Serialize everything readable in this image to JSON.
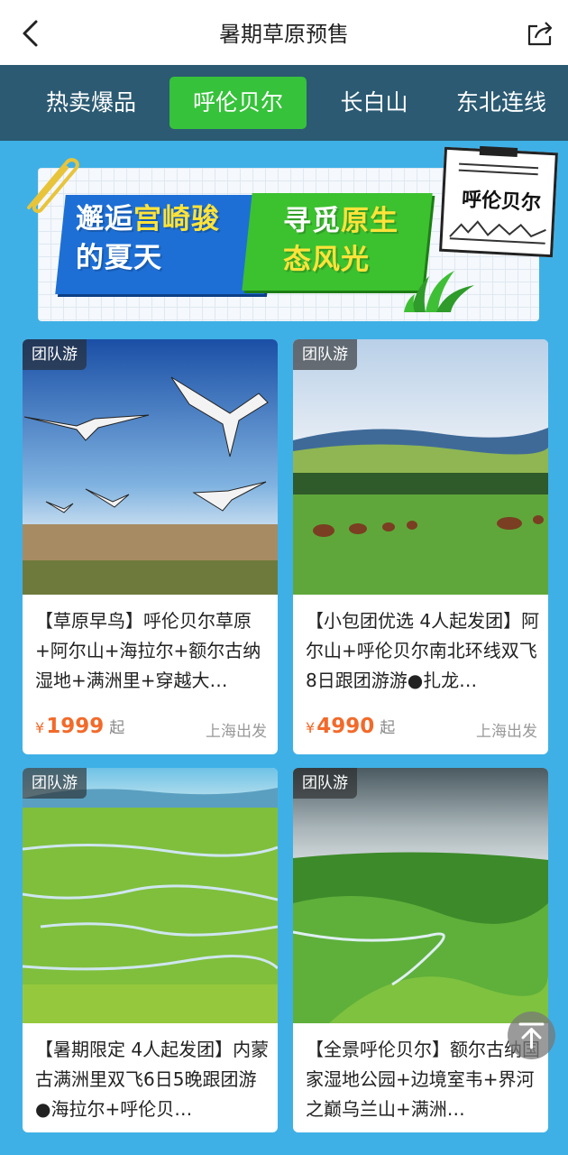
{
  "header": {
    "title": "暑期草原预售",
    "back_icon": "back-arrow-icon",
    "share_icon": "share-icon"
  },
  "tabs": [
    {
      "label": "热卖爆品",
      "active": false
    },
    {
      "label": "呼伦贝尔",
      "active": true
    },
    {
      "label": "长白山",
      "active": false
    },
    {
      "label": "东北连线",
      "active": false
    }
  ],
  "banner": {
    "line1_prefix": "邂逅",
    "line1_highlight": "宫崎骏",
    "line2": "的夏天",
    "right_line1_prefix": "寻觅",
    "right_line1_highlight": "原生",
    "right_line2": "态风光",
    "tag": "呼伦贝尔"
  },
  "products": [
    {
      "badge": "团队游",
      "title": "【草原早鸟】呼伦贝尔草原+阿尔山+海拉尔+额尔古纳湿地+满洲里+穿越大…",
      "currency": "¥",
      "price": "1999",
      "suffix": "起",
      "depart": "上海出发"
    },
    {
      "badge": "团队游",
      "title": "【小包团优选 4人起发团】阿尔山+呼伦贝尔南北环线双飞8日跟团游游●扎龙…",
      "currency": "¥",
      "price": "4990",
      "suffix": "起",
      "depart": "上海出发"
    },
    {
      "badge": "团队游",
      "title": "【暑期限定 4人起发团】内蒙古满洲里双飞6日5晚跟团游●海拉尔+呼伦贝…"
    },
    {
      "badge": "团队游",
      "title": "【全景呼伦贝尔】额尔古纳国家湿地公园+边境室韦+界河之巅乌兰山+满洲…"
    }
  ],
  "colors": {
    "tab_bar": "#2b5a72",
    "active_tab": "#36c23a",
    "page_bg": "#3fb0e6",
    "price": "#f26a2a"
  },
  "scroll_top_icon": "arrow-up-icon"
}
